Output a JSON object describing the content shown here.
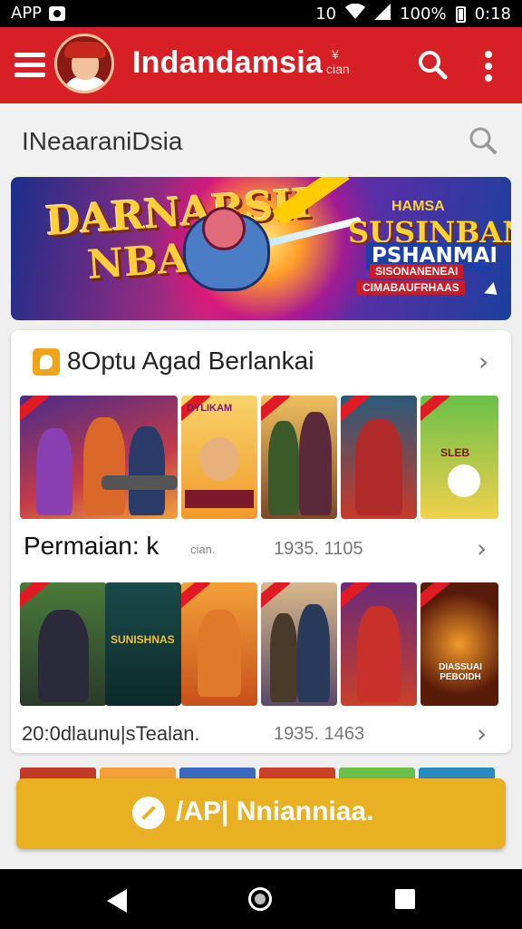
{
  "status_bar": {
    "app_label": "APP",
    "time": "0:18",
    "battery": "100%",
    "extra": "10"
  },
  "app_bar": {
    "title": "Indandamsia",
    "subtitle": "cian",
    "subtitle_mark": "¥"
  },
  "search": {
    "placeholder": "INeaaraniDsia"
  },
  "banner": {
    "title_line1": "DARNARSH",
    "title_line2": "NBANI",
    "ribbon": "",
    "right_small": "HAMSA",
    "right_title": "SUSINBAN.",
    "right_badge": "PSHANMAI",
    "right_line1": "SISONANENEAI",
    "right_line2": "CIMABAUFRHAAS"
  },
  "section": {
    "title": "8Optu Agad Berlankai",
    "rows": [
      {
        "caption": "Permaian: k",
        "meta_small": "cian.",
        "meta": "1935. 1105"
      },
      {
        "caption": "20:0dlaunu|sTealan.",
        "meta_small": "",
        "meta": "1935. 1463"
      }
    ],
    "tile_titles_row1": [
      "",
      "DYLIKAM",
      "",
      "",
      "SLEB"
    ],
    "tile_titles_row2": [
      "",
      "SUNISHNAS",
      "",
      "",
      "",
      "DIASSUAI PEBOIDH"
    ]
  },
  "cta": {
    "label": "/AP| Nnianniaa."
  },
  "colors": {
    "primary": "#d71f26",
    "accent": "#eab023",
    "background": "#efefef"
  },
  "icons": [
    "menu-icon",
    "search-icon",
    "more-vert-icon",
    "chevron-right-icon",
    "back-icon",
    "home-icon",
    "recents-icon"
  ]
}
